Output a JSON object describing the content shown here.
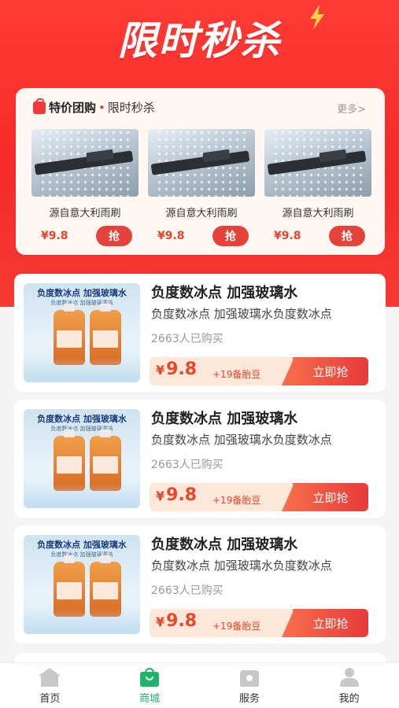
{
  "hero": {
    "title": "限时秒杀"
  },
  "flash": {
    "title": "特价团购",
    "subtitle": "限时秒杀",
    "more": "更多>",
    "items": [
      {
        "name": "源自意大利雨刷",
        "price": "¥9.8",
        "button": "抢"
      },
      {
        "name": "源自意大利雨刷",
        "price": "¥9.8",
        "button": "抢"
      },
      {
        "name": "源自意大利雨刷",
        "price": "¥9.8",
        "button": "抢"
      }
    ]
  },
  "products": [
    {
      "img_title": "负度数冰点 加强玻璃水",
      "img_sub": "负度数冰点 加强玻璃清洁",
      "title": "负度数冰点 加强玻璃水",
      "desc": "负度数冰点 加强玻璃水负度数冰点",
      "sold": "2663人已购买",
      "yen": "¥",
      "price": "9.8",
      "bonus": "+19备胎豆",
      "button": "立即抢"
    },
    {
      "img_title": "负度数冰点 加强玻璃水",
      "img_sub": "负度数冰点 加强玻璃清洁",
      "title": "负度数冰点 加强玻璃水",
      "desc": "负度数冰点 加强玻璃水负度数冰点",
      "sold": "2663人已购买",
      "yen": "¥",
      "price": "9.8",
      "bonus": "+19备胎豆",
      "button": "立即抢"
    },
    {
      "img_title": "负度数冰点 加强玻璃水",
      "img_sub": "负度数冰点 加强玻璃清洁",
      "title": "负度数冰点 加强玻璃水",
      "desc": "负度数冰点 加强玻璃水负度数冰点",
      "sold": "2663人已购买",
      "yen": "¥",
      "price": "9.8",
      "bonus": "+19备胎豆",
      "button": "立即抢"
    }
  ],
  "tabs": [
    {
      "label": "首页",
      "icon": "home-icon"
    },
    {
      "label": "商城",
      "icon": "shop-icon",
      "active": true
    },
    {
      "label": "服务",
      "icon": "service-icon"
    },
    {
      "label": "我的",
      "icon": "profile-icon"
    }
  ],
  "colors": {
    "brand_red": "#f52a2a",
    "accent_green": "#1fb36b",
    "price_orange": "#e8452c"
  }
}
